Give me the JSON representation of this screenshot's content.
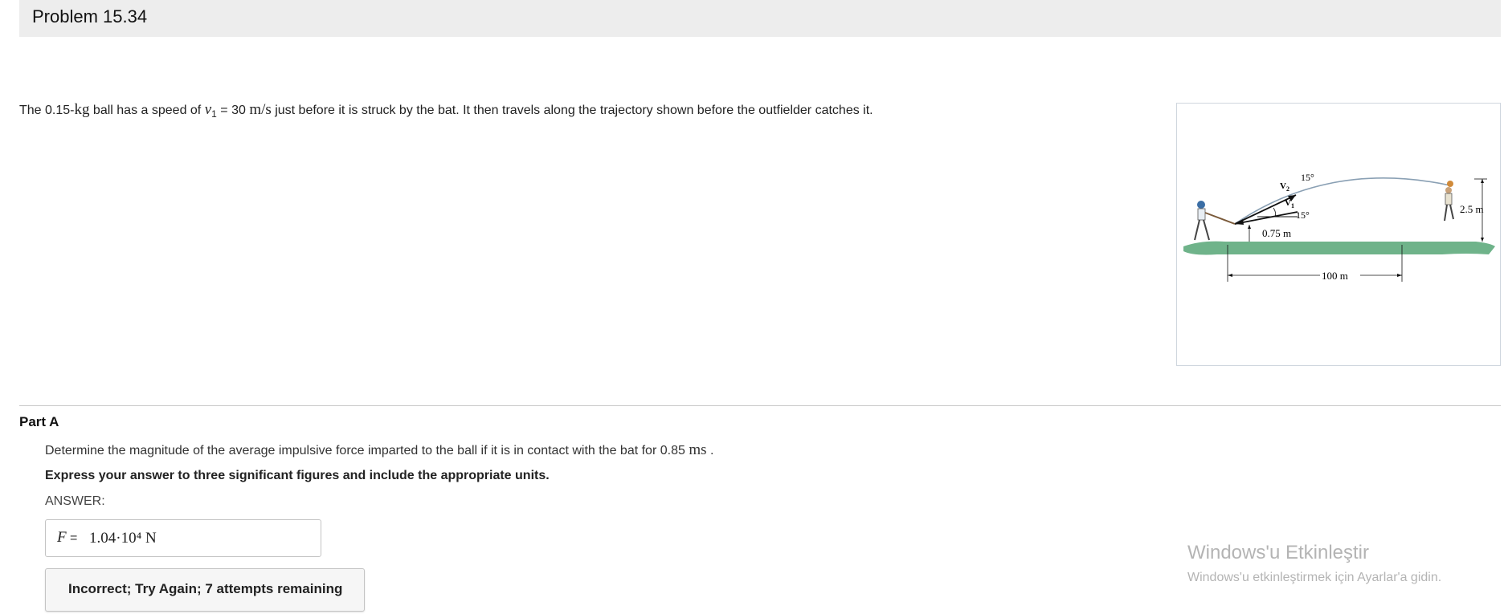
{
  "header": {
    "title": "Problem 15.34"
  },
  "intro": {
    "t1": "The 0.15-",
    "kg": "kg",
    "t2": " ball has a speed of ",
    "v": "v",
    "sub": "1",
    "eq": " = 30 ",
    "unit": "m/s",
    "t3": " just before it is struck by the bat. It then travels along the trajectory shown before the outfielder catches it."
  },
  "figure": {
    "label_v2": "V",
    "label_v2_sub": "2",
    "label_v1": "V",
    "label_v1_sub": "1",
    "angle_top": "15°",
    "angle_bottom": "15°",
    "height_left": "0.75 m",
    "height_right": "2.5 m",
    "distance": "100 m",
    "colors": {
      "ground": "#6fb38a",
      "trajectory": "#8aa0b4"
    }
  },
  "part": {
    "title": "Part A",
    "question_text": "Determine the magnitude of the average impulsive force imparted to the ball if it is in contact with the bat for 0.85 ",
    "question_unit": "ms",
    "question_end": " .",
    "instruction": "Express your answer to three significant figures and include the appropriate units.",
    "answer_label": "ANSWER:",
    "answer_var": "F",
    "answer_eq": " = ",
    "answer_value": "1.04·10⁴ N",
    "feedback": "Incorrect; Try Again; 7 attempts remaining"
  },
  "watermark": {
    "line1": "Windows'u Etkinleştir",
    "line2": "Windows'u etkinleştirmek için Ayarlar'a gidin."
  }
}
